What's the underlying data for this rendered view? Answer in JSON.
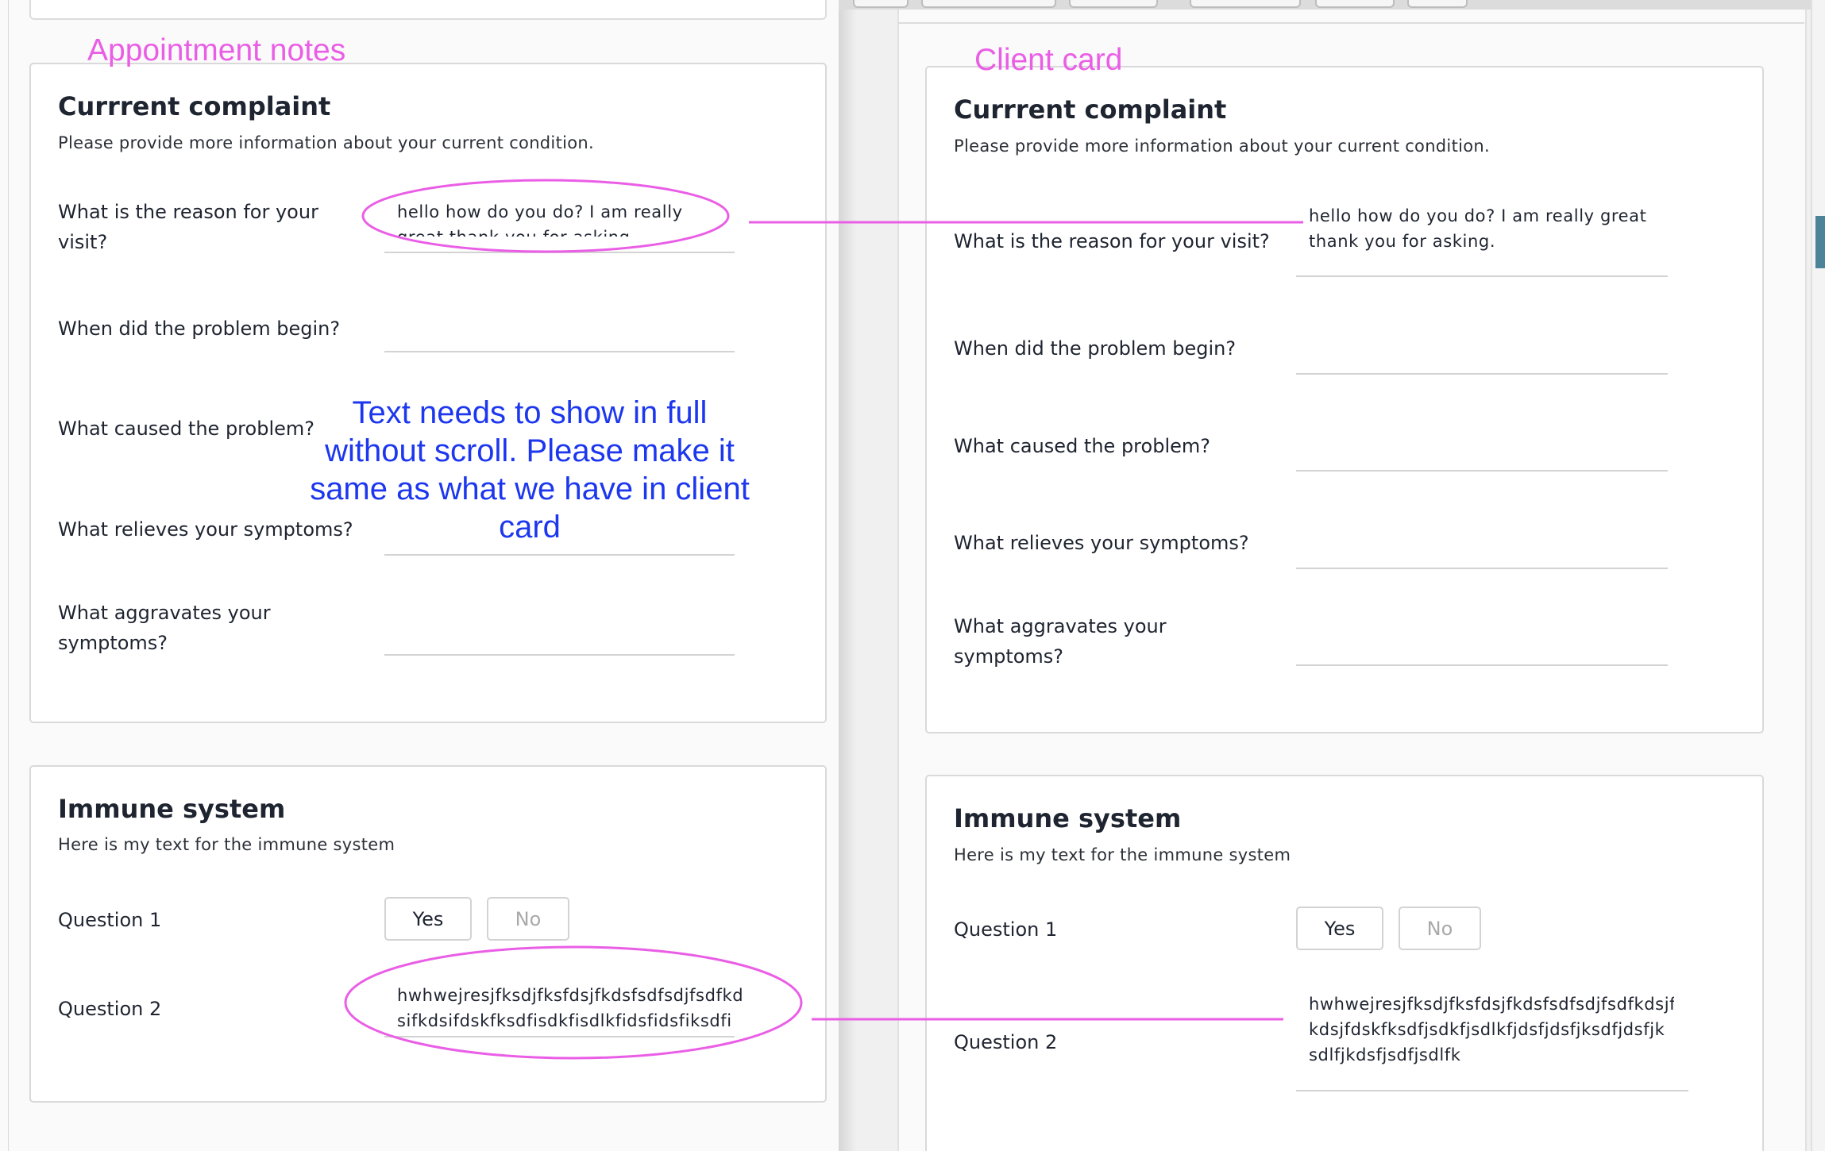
{
  "annotations": {
    "left_caption": "Appointment notes",
    "right_caption": "Client card",
    "note": "Text needs to show in full without scroll. Please make it same as what we have in client card",
    "color_magenta": "#ea5ee6",
    "color_blue": "#1c37ee"
  },
  "appointment_notes": {
    "complaint_card": {
      "title": "Currrent complaint",
      "subtitle": "Please provide more information about your current condition.",
      "q1_label": "What is the reason for your visit?",
      "q1_value": "hello how do you do? I am really great thank you for asking.",
      "q2_label": "When did the problem begin?",
      "q3_label": "What caused the problem?",
      "q4_label": "What relieves your symptoms?",
      "q5_label": "What aggravates your symptoms?"
    },
    "immune_card": {
      "title": "Immune system",
      "subtitle": "Here is my text for the immune system",
      "q1_label": "Question 1",
      "yes_label": "Yes",
      "no_label": "No",
      "q2_label": "Question 2",
      "q2_value": "hwhwejresjfksdjfksfdsjfkdsfsdfsdjfsdfkd sifkdsifdskfksdfisdkfisdlkfidsfidsfiksdfi"
    }
  },
  "client_card": {
    "complaint_card": {
      "title": "Currrent complaint",
      "subtitle": "Please provide more information about your current condition.",
      "q1_label": "What is the reason for your visit?",
      "q1_value": "hello how do you do? I am really great thank you for asking.",
      "q2_label": "When did the problem begin?",
      "q3_label": "What caused the problem?",
      "q4_label": "What relieves your symptoms?",
      "q5_label": "What aggravates your symptoms?"
    },
    "immune_card": {
      "title": "Immune system",
      "subtitle": "Here is my text for the immune system",
      "q1_label": "Question 1",
      "yes_label": "Yes",
      "no_label": "No",
      "q2_label": "Question 2",
      "q2_value": "hwhwejresjfksdjfksfdsjfkdsfsdfsdjfsdfkdsjf kdsjfdskfksdfjsdkfjsdlkfjdsfjdsfjksdfjdsfjk sdlfjkdsfjsdfjsdlfk"
    }
  }
}
